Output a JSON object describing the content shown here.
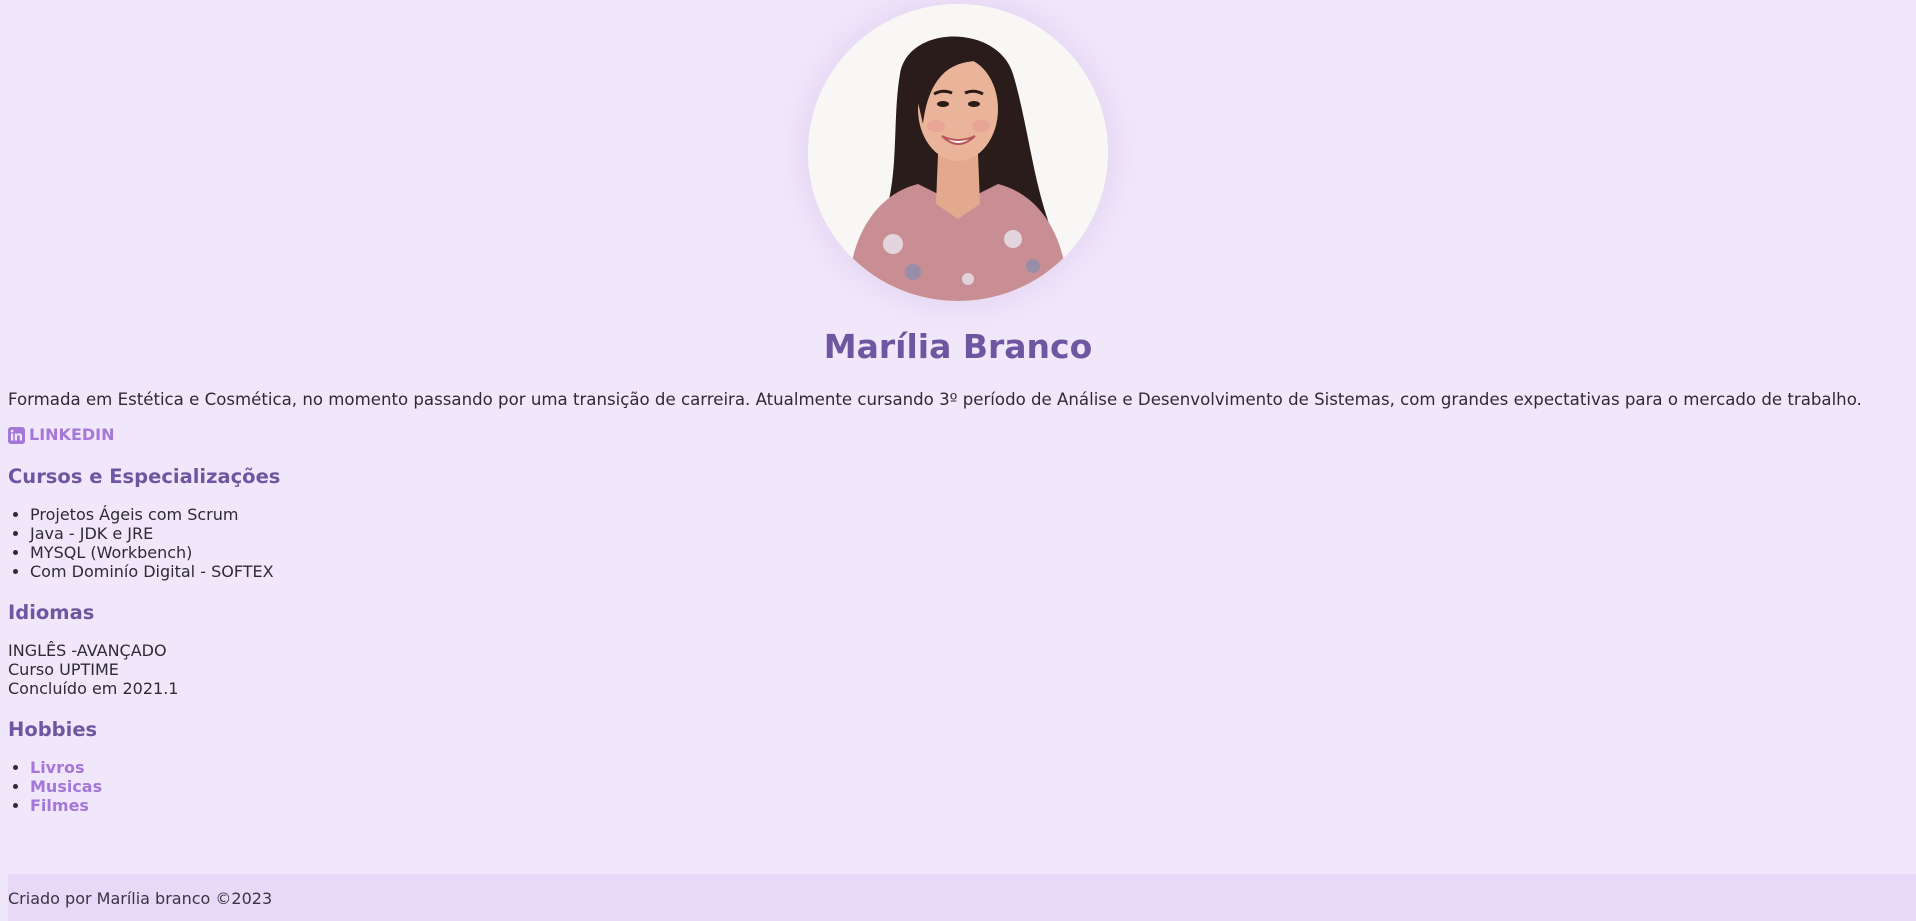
{
  "profile": {
    "photo_icon": "profile-photo",
    "name": "Marília Branco",
    "intro": "Formada em Estética e Cosmética, no momento passando por uma transição de carreira. Atualmente cursando 3º período de Análise e Desenvolvimento de Sistemas, com grandes expectativas para o mercado de trabalho.",
    "linkedin_icon": "linkedin-icon",
    "linkedin_label": "LINKEDIN"
  },
  "cursos": {
    "title": "Cursos e Especializações",
    "items": [
      "Projetos Ágeis com Scrum",
      "Java - JDK e JRE",
      "MYSQL (Workbench)",
      "Com Dominío Digital - SOFTEX"
    ]
  },
  "idiomas": {
    "title": "Idiomas",
    "lines": [
      "INGLÊS -AVANÇADO",
      "Curso UPTIME",
      "Concluído em 2021.1"
    ]
  },
  "hobbies": {
    "title": "Hobbies",
    "items": [
      "Livros",
      "Musicas",
      "Filmes"
    ]
  },
  "footer": {
    "text": "Criado por Marília branco ©2023"
  },
  "colors": {
    "background": "#f1e7fb",
    "heading": "#6f56a0",
    "link": "#a477d8",
    "footer_bg": "#e9d9f9"
  }
}
